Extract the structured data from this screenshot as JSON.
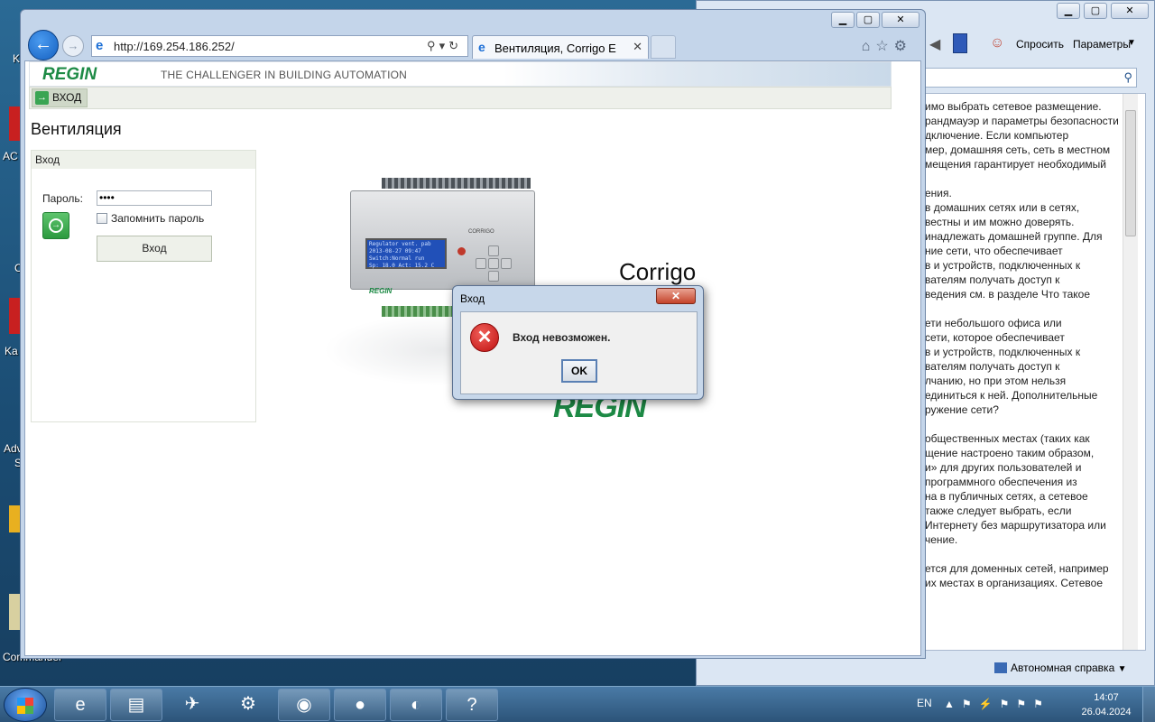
{
  "desktop": {
    "labels": [
      "K",
      "AC",
      "C",
      "Ka",
      "Adv",
      "S",
      "Commander"
    ]
  },
  "help_window": {
    "toolbar": {
      "ask_label": "Спросить",
      "params_label": "Параметры"
    },
    "status": "Автономная справка",
    "text_lines": [
      "имо выбрать сетевое размещение.",
      "рандмауэр и параметры безопасности",
      "дключение. Если компьютер",
      "мер, домашняя сеть, сеть в местном",
      "мещения гарантирует необходимый",
      "",
      "ения.",
      "в домашних сетях или в сетях,",
      "вестны и им можно доверять.",
      "инадлежать домашней группе. Для",
      "ние сети, что обеспечивает",
      "в и устройств, подключенных к",
      "вателям получать доступ к",
      "ведения см. в разделе Что такое",
      "",
      "ети небольшого офиса или",
      "сети, которое обеспечивает",
      "в и устройств, подключенных к",
      "вателям получать доступ к",
      "лчанию, но при этом нельзя",
      "единиться к ней. Дополнительные",
      "ружение сети?",
      "",
      "общественных местах (таких как",
      "щение настроено таким образом,",
      "и» для других пользователей и",
      "программного обеспечения из",
      "на в публичных сетях, а сетевое",
      "также следует выбрать, если",
      "Интернету без маршрутизатора или",
      "чение.",
      "",
      "ется для доменных сетей, например",
      "их местах в организациях. Сетевое"
    ]
  },
  "browser": {
    "url": "http://169.254.186.252/",
    "tab_title": "Вентиляция, Corrigo E",
    "tab_close": "✕"
  },
  "page": {
    "logo": "REGIN",
    "tagline": "THE CHALLENGER IN BUILDING AUTOMATION",
    "menu_item": "ВХОД",
    "title": "Вентиляция",
    "login_panel_title": "Вход",
    "password_label": "Пароль:",
    "password_value": "••••",
    "remember_label": "Запомнить пароль",
    "login_button": "Вход",
    "product_name": "Corrigo",
    "device_brand": "REGIN",
    "device_model": "CORRIGO",
    "lcd_lines": [
      "Regulator vent. pab",
      "2013-08-27 09:47",
      "Switch:Normal run",
      "Sp: 18.0 Act: 15.2 C"
    ],
    "big_logo": "REGIN"
  },
  "dialog": {
    "title": "Вход",
    "close_label": "✕",
    "message": "Вход невозможен.",
    "ok_label": "OK"
  },
  "taskbar": {
    "lang": "EN",
    "time": "14:07",
    "date": "26.04.2024"
  }
}
